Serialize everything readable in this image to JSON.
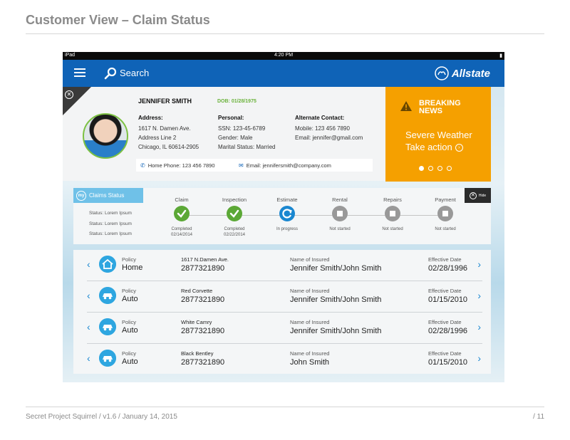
{
  "doc": {
    "title": "Customer View – Claim Status",
    "footer_left": "Secret Project Squirrel  /  v1.6  / January 14, 2015",
    "footer_right": "/  11"
  },
  "statusbar": {
    "device": "iPad",
    "time": "4:20 PM"
  },
  "navbar": {
    "search_label": "Search",
    "brand": "Allstate"
  },
  "profile": {
    "name": "JENNIFER SMITH",
    "dob": "DOB: 01/28/1975",
    "address": {
      "heading": "Address:",
      "line1": "1617 N. Damen Ave.",
      "line2": "Address Line 2",
      "line3": "Chicago, IL 60614-2905"
    },
    "personal": {
      "heading": "Personal:",
      "ssn": "SSN: 123-45-6789",
      "gender": "Gender: Male",
      "marital": "Marital Status: Married"
    },
    "alternate": {
      "heading": "Alternate Contact:",
      "mobile": "Mobile: 123 456 7890",
      "email": "Email: jennifer@gmail.com"
    },
    "home_phone": "Home Phone: 123 456 7890",
    "email": "Email: jennifersmith@company.com"
  },
  "breaking": {
    "title_line1": "BREAKING",
    "title_line2": "NEWS",
    "body_line1": "Severe Weather",
    "body_line2": "Take action",
    "slides": 4,
    "active_slide": 1,
    "color": "#f5a000"
  },
  "claims": {
    "tab_badge": "my",
    "tab_label": "Claims Status",
    "status_lines": [
      "Status: Lorem Ipsum",
      "Status: Lorem Ipsum",
      "Status: Lorem Ipsum"
    ],
    "hide_label": "Hide",
    "steps": [
      {
        "label": "Claim",
        "state": "done",
        "sub1": "Completed",
        "sub2": "02/14/2014"
      },
      {
        "label": "Inspection",
        "state": "done",
        "sub1": "Completed",
        "sub2": "02/22/2014"
      },
      {
        "label": "Estimate",
        "state": "prog",
        "sub1": "In progress",
        "sub2": ""
      },
      {
        "label": "Rental",
        "state": "ns",
        "sub1": "Not started",
        "sub2": ""
      },
      {
        "label": "Repairs",
        "state": "ns",
        "sub1": "Not started",
        "sub2": ""
      },
      {
        "label": "Payment",
        "state": "ns",
        "sub1": "Not started",
        "sub2": ""
      }
    ]
  },
  "policies": [
    {
      "icon": "home-icon",
      "kind_label": "Policy",
      "kind": "Home",
      "desc": "1617 N.Damen Ave.",
      "number": "2877321890",
      "insured_label": "Name of Insured",
      "insured": "Jennifer Smith/John Smith",
      "eff_label": "Effective Date",
      "eff": "02/28/1996"
    },
    {
      "icon": "car-icon",
      "kind_label": "Policy",
      "kind": "Auto",
      "desc": "Red Corvette",
      "number": "2877321890",
      "insured_label": "Name of Insured",
      "insured": "Jennifer Smith/John Smith",
      "eff_label": "Effective Date",
      "eff": "01/15/2010"
    },
    {
      "icon": "car-icon",
      "kind_label": "Policy",
      "kind": "Auto",
      "desc": "White Camry",
      "number": "2877321890",
      "insured_label": "Name of Insured",
      "insured": "Jennifer Smith/John Smith",
      "eff_label": "Effective Date",
      "eff": "02/28/1996"
    },
    {
      "icon": "car-icon",
      "kind_label": "Policy",
      "kind": "Auto",
      "desc": "Black Bentley",
      "number": "2877321890",
      "insured_label": "Name of Insured",
      "insured": "John Smith",
      "eff_label": "Effective Date",
      "eff": "01/15/2010"
    }
  ]
}
